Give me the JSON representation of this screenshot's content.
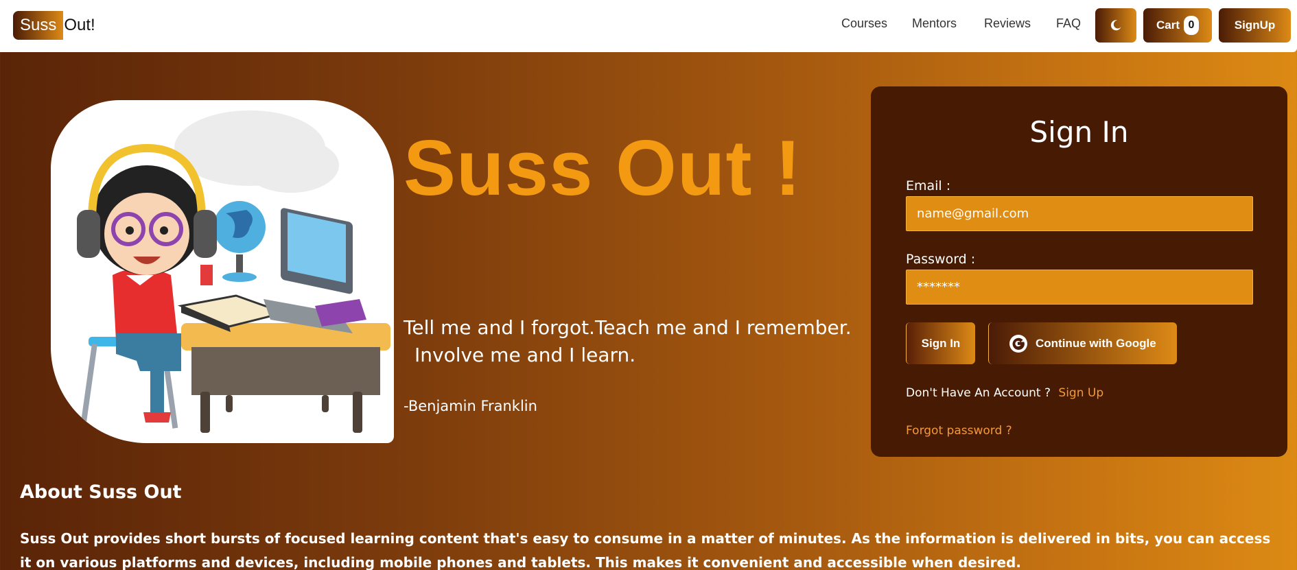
{
  "navbar": {
    "brand_part1": "Suss",
    "brand_part2": "Out!",
    "links": [
      "Courses",
      "Mentors",
      "Reviews",
      "FAQ"
    ],
    "theme_toggle_icon": "moon-icon",
    "cart_label": "Cart",
    "cart_count": "0",
    "signup_label": "SignUp"
  },
  "hero": {
    "title": "Suss Out !",
    "quote_line1": "Tell me and I forgot.Teach me and I remember.",
    "quote_line2": "Involve me and I learn.",
    "quote_author": "-Benjamin Franklin"
  },
  "signin": {
    "title": "Sign In",
    "email_label": "Email :",
    "email_placeholder": "name@gmail.com",
    "password_label": "Password :",
    "password_placeholder": "*******",
    "signin_button": "Sign In",
    "google_button": "Continue with Google",
    "google_icon": "google-icon",
    "no_account_text": "Don't Have An Account ?",
    "signup_link": "Sign Up",
    "forgot_link": "Forgot password ?"
  },
  "about": {
    "heading": "About Suss Out",
    "text": "Suss Out provides short bursts of focused learning content that's easy to consume in a matter of minutes. As the information is delivered in bits, you can access it on various platforms and devices, including mobile phones and tablets. This makes it convenient and accessible when desired."
  },
  "colors": {
    "accent": "#f39a12",
    "card_background": "#461a03",
    "input_background": "#e08d14",
    "link": "#f39a3a"
  }
}
